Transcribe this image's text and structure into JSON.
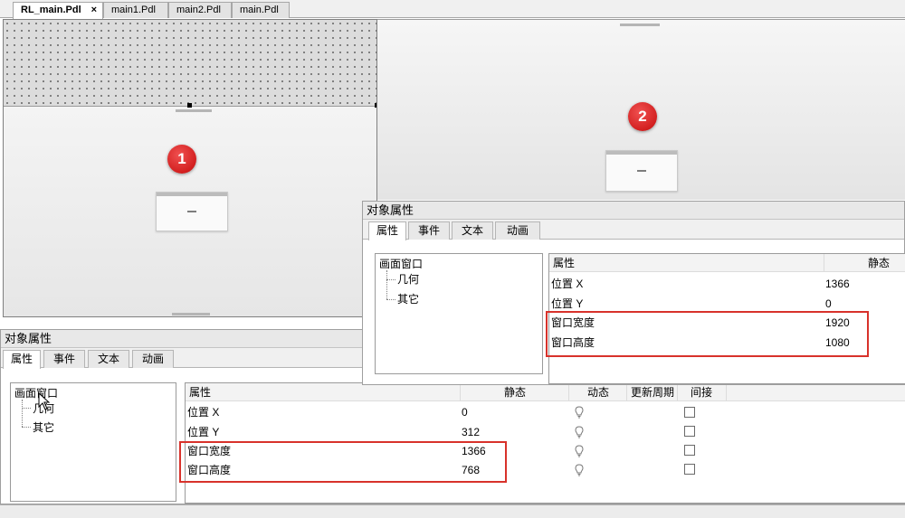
{
  "tabs": [
    {
      "label": "RL_main.Pdl",
      "close": "×"
    },
    {
      "label": "main1.Pdl"
    },
    {
      "label": "main2.Pdl"
    },
    {
      "label": "main.Pdl"
    }
  ],
  "badges": {
    "one": "1",
    "two": "2"
  },
  "panel_bottom": {
    "title": "对象属性",
    "tabs": [
      "属性",
      "事件",
      "文本",
      "动画"
    ],
    "tree": {
      "root": "画面窗口",
      "children": [
        "几何",
        "其它"
      ]
    },
    "columns": [
      "属性",
      "静态",
      "动态",
      "更新周期",
      "间接"
    ],
    "rows": [
      {
        "name": "位置 X",
        "value": "0"
      },
      {
        "name": "位置 Y",
        "value": "312"
      },
      {
        "name": "窗口宽度",
        "value": "1366"
      },
      {
        "name": "窗口高度",
        "value": "768"
      }
    ]
  },
  "panel_top": {
    "title": "对象属性",
    "tabs": [
      "属性",
      "事件",
      "文本",
      "动画"
    ],
    "tree": {
      "root": "画面窗口",
      "children": [
        "几何",
        "其它"
      ]
    },
    "columns": [
      "属性",
      "静态"
    ],
    "rows": [
      {
        "name": "位置 X",
        "value": "1366"
      },
      {
        "name": "位置 Y",
        "value": "0"
      },
      {
        "name": "窗口宽度",
        "value": "1920"
      },
      {
        "name": "窗口高度",
        "value": "1080"
      }
    ]
  },
  "colors": {
    "highlight": "#d8322b",
    "badge": "#d32020"
  },
  "icons": {
    "bulb": "lightbulb-icon",
    "cursor": "mouse-cursor-icon"
  }
}
